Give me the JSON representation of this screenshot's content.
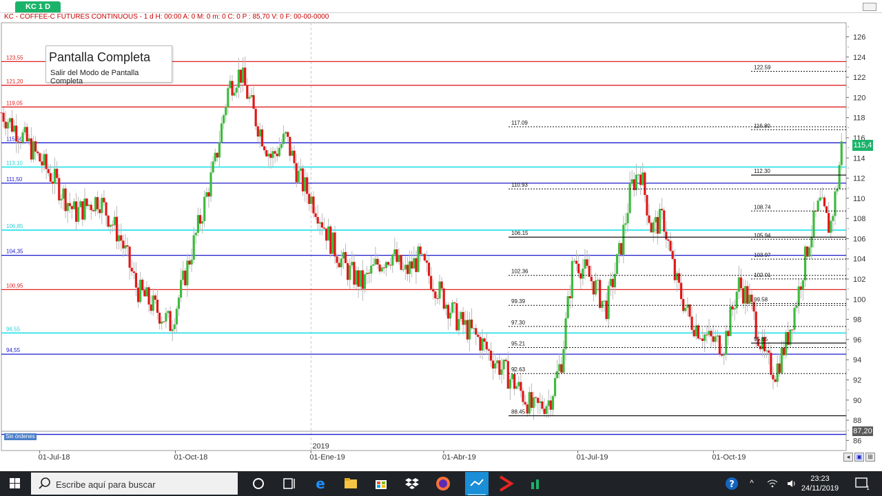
{
  "tab": {
    "label": "KC 1 D"
  },
  "info_line": "KC - COFFEE-C FUTURES CONTINUOUS -  1 d H: 00:00  A: 0  M: 0  m: 0  C: 0  P : 85,70  V: 0  F: 00-00-0000",
  "fullscreen_popup": {
    "title": "Pantalla Completa",
    "subtitle": "Salir del Modo de Pantalla Completa"
  },
  "orders_label": "Sin órdenes",
  "current_price": "115,4",
  "low_price_badge": "87,20",
  "year_marker": "2019",
  "colors": {
    "up": "#3dbb3d",
    "down": "#e01818",
    "red_level": "#e02020",
    "blue_level": "#1a1acc",
    "cyan_level": "#44e4ec",
    "accent": "#1bb36a",
    "taskbar": "#1f2327"
  },
  "chart_data": {
    "type": "candlestick",
    "y_axis": {
      "ticks": [
        86,
        88,
        90,
        92,
        94,
        96,
        98,
        100,
        102,
        104,
        106,
        108,
        110,
        112,
        114,
        116,
        118,
        120,
        122,
        124,
        126
      ],
      "ylim": [
        85.0,
        127.4
      ]
    },
    "x_axis": {
      "labels": [
        "01-Jul-18",
        "01-Oct-18",
        "01-Ene-19",
        "01-Abr-19",
        "01-Jul-19",
        "01-Oct-19"
      ]
    },
    "horizontal_levels": [
      {
        "label": "123,55",
        "value": 123.55,
        "color": "red"
      },
      {
        "label": "121,20",
        "value": 121.2,
        "color": "red"
      },
      {
        "label": "119,05",
        "value": 119.05,
        "color": "red"
      },
      {
        "label": "115,50",
        "value": 115.5,
        "color": "blue"
      },
      {
        "label": "113,10",
        "value": 113.1,
        "color": "cyan"
      },
      {
        "label": "111,50",
        "value": 111.5,
        "color": "blue"
      },
      {
        "label": "106,85",
        "value": 106.85,
        "color": "cyan"
      },
      {
        "label": "104,35",
        "value": 104.35,
        "color": "blue"
      },
      {
        "label": "100,95",
        "value": 100.95,
        "color": "red"
      },
      {
        "label": "96,55",
        "value": 96.65,
        "color": "cyan"
      },
      {
        "label": "94,55",
        "value": 94.55,
        "color": "blue"
      },
      {
        "label": "",
        "value": 86.6,
        "color": "blue"
      }
    ],
    "fib_group_1": [
      {
        "label": "117.09",
        "value": 117.09,
        "style": "dotted"
      },
      {
        "label": "110.93",
        "value": 110.93,
        "style": "dotted"
      },
      {
        "label": "106.15",
        "value": 106.15,
        "style": "solid"
      },
      {
        "label": "102.36",
        "value": 102.36,
        "style": "dotted"
      },
      {
        "label": "99.39",
        "value": 99.39,
        "style": "dotted"
      },
      {
        "label": "97.30",
        "value": 97.3,
        "style": "dotted"
      },
      {
        "label": "95.21",
        "value": 95.21,
        "style": "dotted"
      },
      {
        "label": "92.63",
        "value": 92.63,
        "style": "dotted"
      },
      {
        "label": "88.45",
        "value": 88.45,
        "style": "solid"
      }
    ],
    "fib_group_2": [
      {
        "label": "122.59",
        "value": 122.59,
        "style": "dotted"
      },
      {
        "label": "116.80",
        "value": 116.8,
        "style": "dotted"
      },
      {
        "label": "112.30",
        "value": 112.3,
        "style": "solid"
      },
      {
        "label": "108.74",
        "value": 108.74,
        "style": "dotted"
      },
      {
        "label": "105.94",
        "value": 105.94,
        "style": "dotted"
      },
      {
        "label": "103.97",
        "value": 103.97,
        "style": "dotted"
      },
      {
        "label": "102.01",
        "value": 102.01,
        "style": "dotted"
      },
      {
        "label": "99.58",
        "value": 99.58,
        "style": "dotted"
      },
      {
        "label": "95.65",
        "value": 95.65,
        "style": "solid"
      }
    ],
    "trend_path": [
      [
        "2018-06-05",
        118.5
      ],
      [
        "2018-06-20",
        116
      ],
      [
        "2018-07-10",
        112
      ],
      [
        "2018-07-25",
        108.5
      ],
      [
        "2018-08-10",
        110
      ],
      [
        "2018-08-25",
        106
      ],
      [
        "2018-09-05",
        101
      ],
      [
        "2018-09-18",
        99
      ],
      [
        "2018-09-28",
        97.5
      ],
      [
        "2018-10-05",
        101
      ],
      [
        "2018-10-18",
        108
      ],
      [
        "2018-10-28",
        113.5
      ],
      [
        "2018-11-06",
        121
      ],
      [
        "2018-11-14",
        122.5
      ],
      [
        "2018-11-24",
        118
      ],
      [
        "2018-12-05",
        114
      ],
      [
        "2018-12-15",
        116
      ],
      [
        "2018-12-24",
        112
      ],
      [
        "2019-01-05",
        109
      ],
      [
        "2019-01-15",
        105.5
      ],
      [
        "2019-01-25",
        103
      ],
      [
        "2019-02-05",
        101.5
      ],
      [
        "2019-02-15",
        103.5
      ],
      [
        "2019-02-25",
        104.5
      ],
      [
        "2019-03-05",
        102.5
      ],
      [
        "2019-03-15",
        104
      ],
      [
        "2019-03-28",
        101
      ],
      [
        "2019-04-10",
        98
      ],
      [
        "2019-04-25",
        96
      ],
      [
        "2019-05-08",
        93.5
      ],
      [
        "2019-05-20",
        91.5
      ],
      [
        "2019-06-01",
        89
      ],
      [
        "2019-06-12",
        90
      ],
      [
        "2019-06-20",
        94
      ],
      [
        "2019-06-28",
        104
      ],
      [
        "2019-07-05",
        103
      ],
      [
        "2019-07-12",
        101.5
      ],
      [
        "2019-07-20",
        99
      ],
      [
        "2019-07-30",
        105
      ],
      [
        "2019-08-06",
        111
      ],
      [
        "2019-08-12",
        113
      ],
      [
        "2019-08-20",
        107
      ],
      [
        "2019-08-28",
        108
      ],
      [
        "2019-09-05",
        102
      ],
      [
        "2019-09-15",
        98
      ],
      [
        "2019-09-28",
        96
      ],
      [
        "2019-10-08",
        95.5
      ],
      [
        "2019-10-18",
        101.5
      ],
      [
        "2019-10-25",
        100
      ],
      [
        "2019-11-05",
        94
      ],
      [
        "2019-11-12",
        92.8
      ],
      [
        "2019-11-20",
        96
      ],
      [
        "2019-11-28",
        101
      ],
      [
        "2019-12-05",
        106
      ],
      [
        "2019-12-12",
        109.5
      ],
      [
        "2019-12-19",
        107
      ],
      [
        "2019-12-24",
        111.5
      ],
      [
        "2019-12-27",
        115.4
      ]
    ]
  },
  "taskbar": {
    "search_placeholder": "Escribe aquí para buscar",
    "time": "23:23",
    "date": "24/11/2019",
    "notification_count": "1",
    "icons": [
      "windows-start-icon",
      "search-icon",
      "cortana-icon",
      "task-view-icon",
      "edge-icon",
      "file-explorer-icon",
      "store-icon",
      "dropbox-icon",
      "firefox-icon",
      "trading-app-icon",
      "broker-app-icon",
      "chart-app-icon"
    ]
  }
}
